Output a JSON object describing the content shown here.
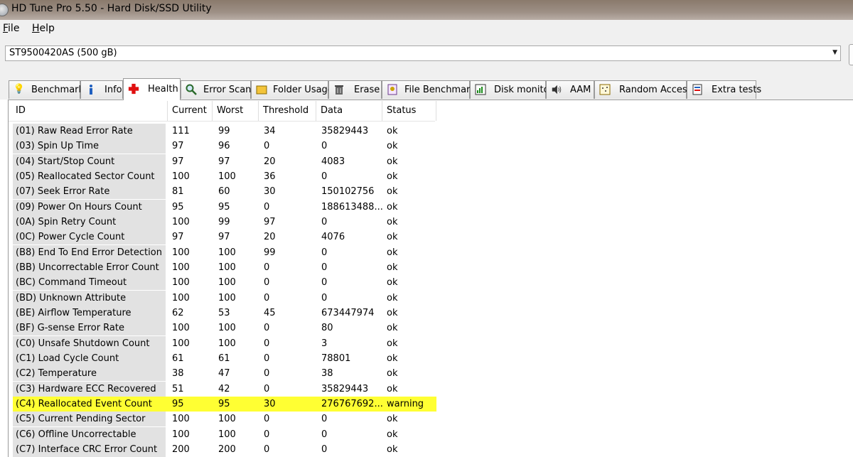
{
  "window": {
    "title": "HD Tune Pro 5.50 - Hard Disk/SSD Utility"
  },
  "menu": {
    "file": "File",
    "help": "Help"
  },
  "drive": {
    "selected": "ST9500420AS (500 gB)"
  },
  "tabs": [
    {
      "label": "Benchmark",
      "icon": "lightbulb-icon"
    },
    {
      "label": "Info",
      "icon": "info-icon"
    },
    {
      "label": "Health",
      "icon": "red-cross-icon"
    },
    {
      "label": "Error Scan",
      "icon": "magnifier-icon"
    },
    {
      "label": "Folder Usage",
      "icon": "folder-icon"
    },
    {
      "label": "Erase",
      "icon": "trash-icon"
    },
    {
      "label": "File Benchmark",
      "icon": "file-benchmark-icon"
    },
    {
      "label": "Disk monitor",
      "icon": "disk-monitor-icon"
    },
    {
      "label": "AAM",
      "icon": "speaker-icon"
    },
    {
      "label": "Random Access",
      "icon": "random-access-icon"
    },
    {
      "label": "Extra tests",
      "icon": "extra-tests-icon"
    }
  ],
  "active_tab": "Health",
  "table": {
    "columns": [
      "ID",
      "Current",
      "Worst",
      "Threshold",
      "Data",
      "Status"
    ],
    "rows": [
      {
        "id": "(01) Raw Read Error Rate",
        "current": "111",
        "worst": "99",
        "threshold": "34",
        "data": "35829443",
        "status": "ok"
      },
      {
        "id": "(03) Spin Up Time",
        "current": "97",
        "worst": "96",
        "threshold": "0",
        "data": "0",
        "status": "ok"
      },
      {
        "id": "(04) Start/Stop Count",
        "current": "97",
        "worst": "97",
        "threshold": "20",
        "data": "4083",
        "status": "ok"
      },
      {
        "id": "(05) Reallocated Sector Count",
        "current": "100",
        "worst": "100",
        "threshold": "36",
        "data": "0",
        "status": "ok"
      },
      {
        "id": "(07) Seek Error Rate",
        "current": "81",
        "worst": "60",
        "threshold": "30",
        "data": "150102756",
        "status": "ok"
      },
      {
        "id": "(09) Power On Hours Count",
        "current": "95",
        "worst": "95",
        "threshold": "0",
        "data": "188613488...",
        "status": "ok"
      },
      {
        "id": "(0A) Spin Retry Count",
        "current": "100",
        "worst": "99",
        "threshold": "97",
        "data": "0",
        "status": "ok"
      },
      {
        "id": "(0C) Power Cycle Count",
        "current": "97",
        "worst": "97",
        "threshold": "20",
        "data": "4076",
        "status": "ok"
      },
      {
        "id": "(B8) End To End Error Detection",
        "current": "100",
        "worst": "100",
        "threshold": "99",
        "data": "0",
        "status": "ok"
      },
      {
        "id": "(BB) Uncorrectable Error Count",
        "current": "100",
        "worst": "100",
        "threshold": "0",
        "data": "0",
        "status": "ok"
      },
      {
        "id": "(BC) Command Timeout",
        "current": "100",
        "worst": "100",
        "threshold": "0",
        "data": "0",
        "status": "ok"
      },
      {
        "id": "(BD) Unknown Attribute",
        "current": "100",
        "worst": "100",
        "threshold": "0",
        "data": "0",
        "status": "ok"
      },
      {
        "id": "(BE) Airflow Temperature",
        "current": "62",
        "worst": "53",
        "threshold": "45",
        "data": "673447974",
        "status": "ok"
      },
      {
        "id": "(BF) G-sense Error Rate",
        "current": "100",
        "worst": "100",
        "threshold": "0",
        "data": "80",
        "status": "ok"
      },
      {
        "id": "(C0) Unsafe Shutdown Count",
        "current": "100",
        "worst": "100",
        "threshold": "0",
        "data": "3",
        "status": "ok"
      },
      {
        "id": "(C1) Load Cycle Count",
        "current": "61",
        "worst": "61",
        "threshold": "0",
        "data": "78801",
        "status": "ok"
      },
      {
        "id": "(C2) Temperature",
        "current": "38",
        "worst": "47",
        "threshold": "0",
        "data": "38",
        "status": "ok"
      },
      {
        "id": "(C3) Hardware ECC Recovered",
        "current": "51",
        "worst": "42",
        "threshold": "0",
        "data": "35829443",
        "status": "ok"
      },
      {
        "id": "(C4) Reallocated Event Count",
        "current": "95",
        "worst": "95",
        "threshold": "30",
        "data": "276767692...",
        "status": "warning"
      },
      {
        "id": "(C5) Current Pending Sector",
        "current": "100",
        "worst": "100",
        "threshold": "0",
        "data": "0",
        "status": "ok"
      },
      {
        "id": "(C6) Offline Uncorrectable",
        "current": "100",
        "worst": "100",
        "threshold": "0",
        "data": "0",
        "status": "ok"
      },
      {
        "id": "(C7) Interface CRC Error Count",
        "current": "200",
        "worst": "200",
        "threshold": "0",
        "data": "0",
        "status": "ok"
      }
    ]
  },
  "colors": {
    "warning_row": "#ffff33",
    "id_column_bg": "#e2e2e2"
  }
}
